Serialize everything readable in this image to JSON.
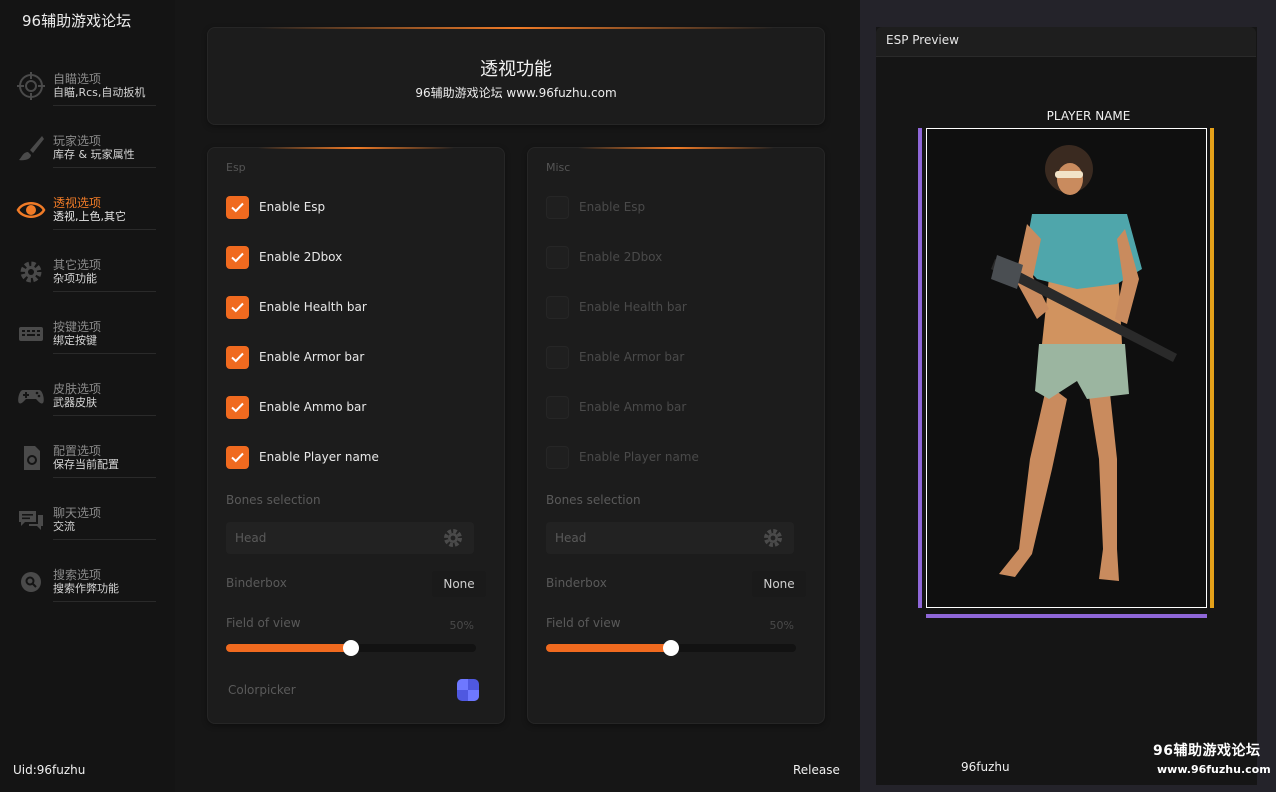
{
  "app": {
    "title": "96辅助游戏论坛"
  },
  "sidebar": {
    "items": [
      {
        "title": "自瞄选项",
        "subtitle": "自瞄,Rcs,自动扳机",
        "icon": "crosshair-icon"
      },
      {
        "title": "玩家选项",
        "subtitle": "库存 & 玩家属性",
        "icon": "brush-icon"
      },
      {
        "title": "透视选项",
        "subtitle": "透视,上色,其它",
        "icon": "eye-icon",
        "active": true
      },
      {
        "title": "其它选项",
        "subtitle": "杂项功能",
        "icon": "gear-icon"
      },
      {
        "title": "按键选项",
        "subtitle": "绑定按键",
        "icon": "keyboard-icon"
      },
      {
        "title": "皮肤选项",
        "subtitle": "武器皮肤",
        "icon": "gamepad-icon"
      },
      {
        "title": "配置选项",
        "subtitle": "保存当前配置",
        "icon": "config-file-icon"
      },
      {
        "title": "聊天选项",
        "subtitle": "交流",
        "icon": "chat-icon"
      },
      {
        "title": "搜索选项",
        "subtitle": "搜索作弊功能",
        "icon": "search-icon"
      }
    ]
  },
  "header": {
    "title": "透视功能",
    "subtitle": "96辅助游戏论坛 www.96fuzhu.com"
  },
  "esp_panel": {
    "label": "Esp",
    "checkboxes": [
      {
        "label": "Enable Esp",
        "checked": true
      },
      {
        "label": "Enable 2Dbox",
        "checked": true
      },
      {
        "label": "Enable Health bar",
        "checked": true
      },
      {
        "label": "Enable Armor bar",
        "checked": true
      },
      {
        "label": "Enable Ammo bar",
        "checked": true
      },
      {
        "label": "Enable Player name",
        "checked": true
      }
    ],
    "bones_label": "Bones selection",
    "bones_value": "Head",
    "binderbox_label": "Binderbox",
    "binderbox_value": "None",
    "fov_label": "Field of view",
    "fov_value": "50%",
    "fov_fraction": 0.5,
    "colorpicker_label": "Colorpicker"
  },
  "misc_panel": {
    "label": "Misc",
    "checkboxes": [
      {
        "label": "Enable Esp",
        "checked": false
      },
      {
        "label": "Enable 2Dbox",
        "checked": false
      },
      {
        "label": "Enable Health bar",
        "checked": false
      },
      {
        "label": "Enable Armor bar",
        "checked": false
      },
      {
        "label": "Enable Ammo bar",
        "checked": false
      },
      {
        "label": "Enable Player name",
        "checked": false
      }
    ],
    "bones_label": "Bones selection",
    "bones_value": "Head",
    "binderbox_label": "Binderbox",
    "binderbox_value": "None",
    "fov_label": "Field of view",
    "fov_value": "50%",
    "fov_fraction": 0.5
  },
  "footer": {
    "uid": "Uid:96fuzhu",
    "release": "Release"
  },
  "preview": {
    "title": "ESP Preview",
    "player_name": "PLAYER NAME",
    "footer_text": "96fuzhu"
  },
  "watermark": {
    "main": "96辅助游戏论坛",
    "url": "www.96fuzhu.com"
  },
  "colors": {
    "accent": "#f06a1f",
    "active_nav": "#f07b27",
    "health_bar": "#8f67d8",
    "armor_bar": "#e5a119",
    "swatch": "#4f58e0"
  }
}
